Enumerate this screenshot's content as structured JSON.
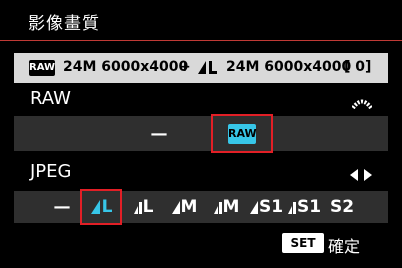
{
  "header": {
    "title": "影像畫質"
  },
  "info": {
    "raw_chip": "RAW",
    "raw_text": "24M 6000x4000",
    "plus": "+",
    "jpeg_text": "24M 6000x4000",
    "shots": "[      0]"
  },
  "raw": {
    "label": "RAW",
    "options": [
      {
        "label": "—",
        "selected": false
      },
      {
        "label": "RAW",
        "selected": true
      }
    ]
  },
  "jpeg": {
    "label": "JPEG",
    "options": [
      {
        "label": "—",
        "selected": false
      },
      {
        "label": "L",
        "selected": true
      },
      {
        "label": "L",
        "selected": false
      },
      {
        "label": "M",
        "selected": false
      },
      {
        "label": "M",
        "selected": false
      },
      {
        "label": "S1",
        "selected": false
      },
      {
        "label": "S1",
        "selected": false
      },
      {
        "label": "S2",
        "selected": false
      }
    ]
  },
  "footer": {
    "set_chip": "SET",
    "confirm_label": "確定"
  },
  "colors": {
    "accent_red": "#e21f26",
    "highlight_cyan": "#37c6e8",
    "title_rule": "#c03a36"
  },
  "icons": {
    "raw_dial": "main-dial-icon",
    "jpeg_arrows": "left-right-arrows-icon"
  }
}
